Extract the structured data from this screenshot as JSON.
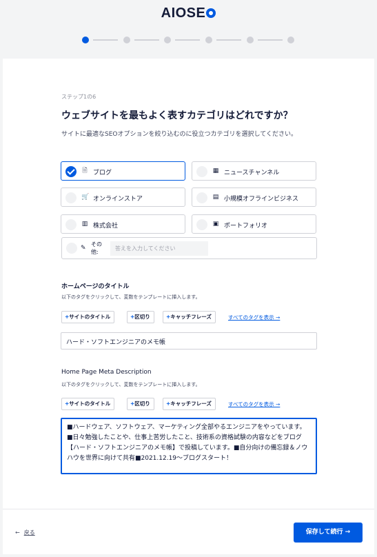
{
  "header": {
    "logo_main": "AIOSE",
    "logo_tail": "O"
  },
  "progress": {
    "current_step": 1,
    "total_steps": 6
  },
  "step_label": "ステップ1の6",
  "title": "ウェブサイトを最もよく表すカテゴリはどれですか？",
  "subtitle": "サイトに最適なSEOオプションを絞り込むのに役立つカテゴリを選択してください。",
  "categories": [
    {
      "label": "ブログ",
      "icon": "document-icon",
      "selected": true
    },
    {
      "label": "ニュースチャンネル",
      "icon": "calendar-icon",
      "selected": false
    },
    {
      "label": "オンラインストア",
      "icon": "cart-icon",
      "selected": false
    },
    {
      "label": "小規模オフラインビジネス",
      "icon": "store-icon",
      "selected": false
    },
    {
      "label": "株式会社",
      "icon": "building-icon",
      "selected": false
    },
    {
      "label": "ポートフォリオ",
      "icon": "gallery-icon",
      "selected": false
    }
  ],
  "other": {
    "label": "その他:",
    "placeholder": "答えを入力してください",
    "icon": "pencil-icon"
  },
  "home_title_section": {
    "heading": "ホームページのタイトル",
    "desc": "以下のタグをクリックして、変数をテンプレートに挿入します。",
    "tags": [
      "サイトのタイトル",
      "区切り",
      "キャッチフレーズ"
    ],
    "all_tags": "すべてのタグを表示 →",
    "value": "ハード・ソフトエンジニアのメモ帳"
  },
  "meta_desc_section": {
    "heading": "Home Page Meta Description",
    "desc": "以下のタグをクリックして、変数をテンプレートに挿入します。",
    "tags": [
      "サイトのタイトル",
      "区切り",
      "キャッチフレーズ"
    ],
    "all_tags": "すべてのタグを表示 →",
    "value": "■ハードウェア、ソフトウェア、マーケティング全部やるエンジニアをやっています。■日々勉強したことや、仕事上苦労したこと、技術系の資格試験の内容などをブログ【ハード・ソフトエンジニアのメモ帳】で投稿しています。■自分向けの備忘録＆ノウハウを世界に向けて共有■2021.12.19～ブログスタート！"
  },
  "footer": {
    "back_arrow": "←",
    "back_label": "戻る",
    "save_label": "保存して続行 →"
  },
  "colors": {
    "accent": "#005ae0",
    "text": "#141b38"
  }
}
